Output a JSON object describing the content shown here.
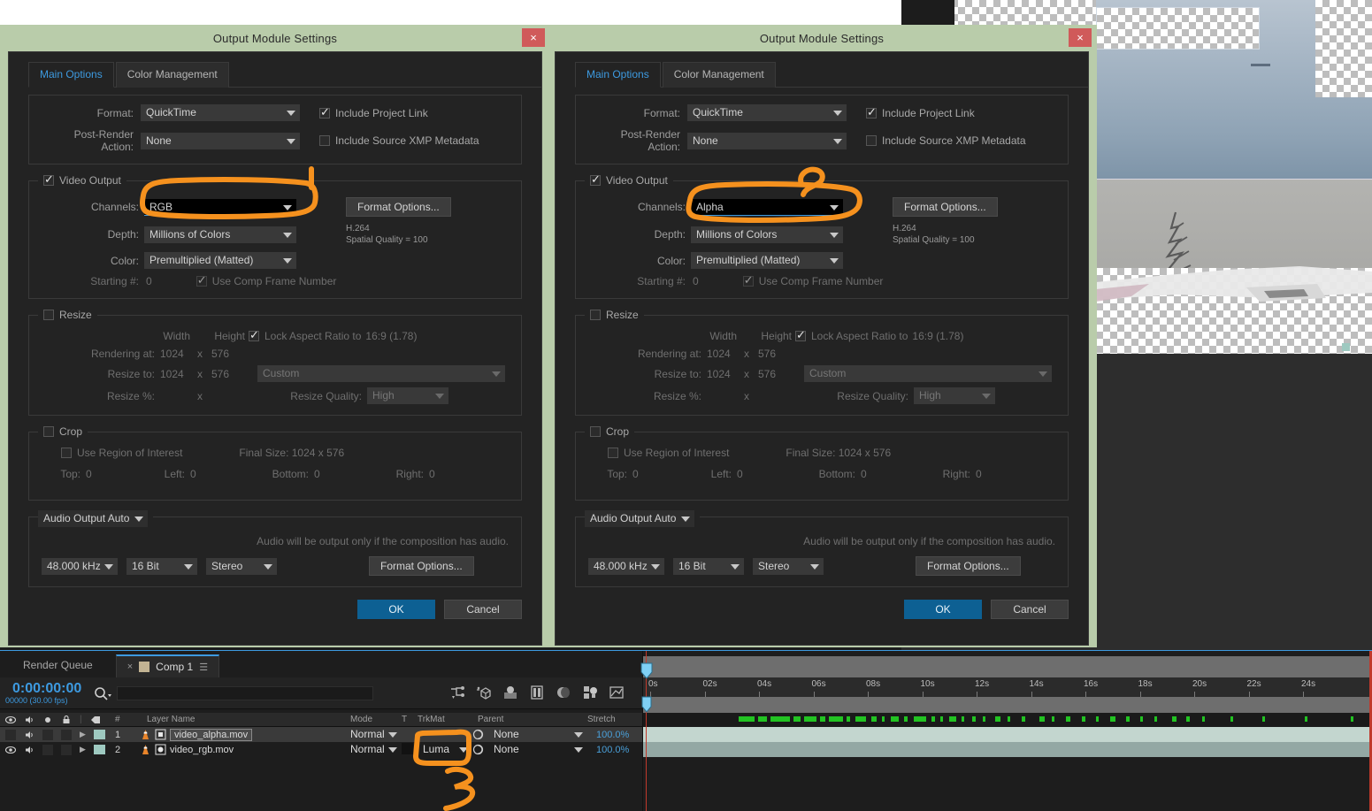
{
  "dialogs": [
    {
      "title": "Output Module Settings",
      "close_label": "×",
      "tabs": [
        {
          "label": "Main Options",
          "active": true
        },
        {
          "label": "Color Management",
          "active": false
        }
      ],
      "format_label": "Format:",
      "format_value": "QuickTime",
      "post_render_label": "Post-Render Action:",
      "post_render_value": "None",
      "include_project_link": "Include Project Link",
      "include_xmp": "Include Source XMP Metadata",
      "video_output": "Video Output",
      "channels_label": "Channels:",
      "channels_value": "RGB",
      "depth_label": "Depth:",
      "depth_value": "Millions of Colors",
      "color_label": "Color:",
      "color_value": "Premultiplied (Matted)",
      "starting_label": "Starting #:",
      "starting_value": "0",
      "use_comp_frame": "Use Comp Frame Number",
      "format_options": "Format Options...",
      "codec_line1": "H.264",
      "codec_line2": "Spatial Quality = 100",
      "resize": "Resize",
      "width_label": "Width",
      "height_label": "Height",
      "lock_aspect": "Lock Aspect Ratio to",
      "lock_aspect_value": "16:9 (1.78)",
      "rendering_at_label": "Rendering at:",
      "rendering_w": "1024",
      "rendering_x": "x",
      "rendering_h": "576",
      "resize_to_label": "Resize to:",
      "resize_w": "1024",
      "resize_x": "x",
      "resize_h": "576",
      "resize_preset": "Custom",
      "resize_pct_label": "Resize %:",
      "resize_pct_x": "x",
      "resize_quality_label": "Resize Quality:",
      "resize_quality_value": "High",
      "crop": "Crop",
      "use_roi": "Use Region of Interest",
      "final_size": "Final Size: 1024 x 576",
      "top_label": "Top:",
      "top_value": "0",
      "left_label": "Left:",
      "left_value": "0",
      "bottom_label": "Bottom:",
      "bottom_value": "0",
      "right_label": "Right:",
      "right_value": "0",
      "audio_output": "Audio Output Auto",
      "audio_note": "Audio will be output only if the composition has audio.",
      "audio_rate": "48.000 kHz",
      "audio_bits": "16 Bit",
      "audio_channels": "Stereo",
      "audio_format_options": "Format Options...",
      "ok": "OK",
      "cancel": "Cancel"
    },
    {
      "title": "Output Module Settings",
      "close_label": "×",
      "tabs": [
        {
          "label": "Main Options",
          "active": true
        },
        {
          "label": "Color Management",
          "active": false
        }
      ],
      "format_label": "Format:",
      "format_value": "QuickTime",
      "post_render_label": "Post-Render Action:",
      "post_render_value": "None",
      "include_project_link": "Include Project Link",
      "include_xmp": "Include Source XMP Metadata",
      "video_output": "Video Output",
      "channels_label": "Channels:",
      "channels_value": "Alpha",
      "depth_label": "Depth:",
      "depth_value": "Millions of Colors",
      "color_label": "Color:",
      "color_value": "Premultiplied (Matted)",
      "starting_label": "Starting #:",
      "starting_value": "0",
      "use_comp_frame": "Use Comp Frame Number",
      "format_options": "Format Options...",
      "codec_line1": "H.264",
      "codec_line2": "Spatial Quality = 100",
      "resize": "Resize",
      "width_label": "Width",
      "height_label": "Height",
      "lock_aspect": "Lock Aspect Ratio to",
      "lock_aspect_value": "16:9 (1.78)",
      "rendering_at_label": "Rendering at:",
      "rendering_w": "1024",
      "rendering_x": "x",
      "rendering_h": "576",
      "resize_to_label": "Resize to:",
      "resize_w": "1024",
      "resize_x": "x",
      "resize_h": "576",
      "resize_preset": "Custom",
      "resize_pct_label": "Resize %:",
      "resize_pct_x": "x",
      "resize_quality_label": "Resize Quality:",
      "resize_quality_value": "High",
      "crop": "Crop",
      "use_roi": "Use Region of Interest",
      "final_size": "Final Size: 1024 x 576",
      "top_label": "Top:",
      "top_value": "0",
      "left_label": "Left:",
      "left_value": "0",
      "bottom_label": "Bottom:",
      "bottom_value": "0",
      "right_label": "Right:",
      "right_value": "0",
      "audio_output": "Audio Output Auto",
      "audio_note": "Audio will be output only if the composition has audio.",
      "audio_rate": "48.000 kHz",
      "audio_bits": "16 Bit",
      "audio_channels": "Stereo",
      "audio_format_options": "Format Options...",
      "ok": "OK",
      "cancel": "Cancel"
    }
  ],
  "annotations": [
    {
      "id": "1",
      "target": "channels-rgb-dropdown",
      "color": "#f5911e"
    },
    {
      "id": "2",
      "target": "channels-alpha-dropdown",
      "color": "#f5911e"
    },
    {
      "id": "3",
      "target": "trkmat-luma-dropdown",
      "color": "#f5911e"
    }
  ],
  "timeline": {
    "panel_tabs": [
      {
        "label": "Render Queue",
        "active": false
      },
      {
        "label": "Comp 1",
        "active": true,
        "close": "×",
        "menu": "☰"
      }
    ],
    "timecode": "0:00:00:00",
    "timecode_sub": "00000 (30.00 fps)",
    "search_placeholder": "",
    "toolbar_icons": [
      "composition-mini-flowchart-icon",
      "draft-3d-icon",
      "hide-shy-layers-icon",
      "frame-blending-icon",
      "motion-blur-icon",
      "graph-editor-icon",
      "auto-keyframe-icon"
    ],
    "columns": [
      {
        "label": ""
      },
      {
        "label": "#"
      },
      {
        "label": "Layer Name"
      },
      {
        "label": "Mode"
      },
      {
        "label": "T"
      },
      {
        "label": "TrkMat"
      },
      {
        "label": "Parent"
      },
      {
        "label": "Stretch"
      }
    ],
    "layers": [
      {
        "index": "1",
        "name": "video_alpha.mov",
        "mode": "Normal",
        "trkmat": "",
        "parent": "None",
        "stretch": "100.0%",
        "selected": true,
        "visible": false,
        "audio": true
      },
      {
        "index": "2",
        "name": "video_rgb.mov",
        "mode": "Normal",
        "trkmat": "Luma",
        "parent": "None",
        "stretch": "100.0%",
        "selected": false,
        "visible": true,
        "audio": true
      }
    ],
    "ruler_ticks": [
      "0s",
      "02s",
      "04s",
      "06s",
      "08s",
      "10s",
      "12s",
      "14s",
      "16s",
      "18s",
      "20s",
      "22s",
      "24s"
    ]
  },
  "colors": {
    "accent_blue": "#3d9ae0",
    "ok_button": "#0d6093",
    "annotation_orange": "#f5911e",
    "title_bar": "#b9ccaa",
    "close_red": "#d05a5a",
    "panel_bg": "#232323",
    "track1": "#c3d6cf",
    "track2": "#93a8a4"
  }
}
